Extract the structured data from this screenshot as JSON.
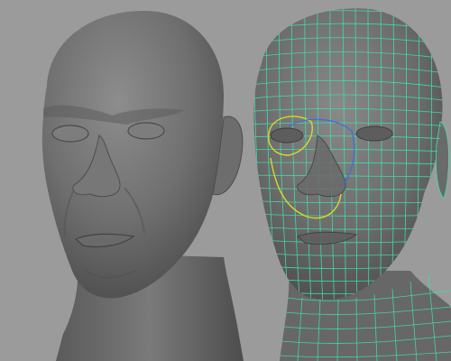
{
  "viewport": {
    "background": "#9b9b9b",
    "panels": [
      {
        "name": "smooth-shaded-head",
        "shading": "smooth"
      },
      {
        "name": "wireframe-on-shaded-head",
        "shading": "wireframe-on-shaded"
      }
    ]
  },
  "colors": {
    "mesh_base": "#6f6f6f",
    "mesh_light": "#8a8a8a",
    "mesh_dark": "#3f3f3f",
    "wire": "#40e0a8",
    "selection_yellow": "#d8d82a",
    "selection_blue": "#3d6de0"
  }
}
